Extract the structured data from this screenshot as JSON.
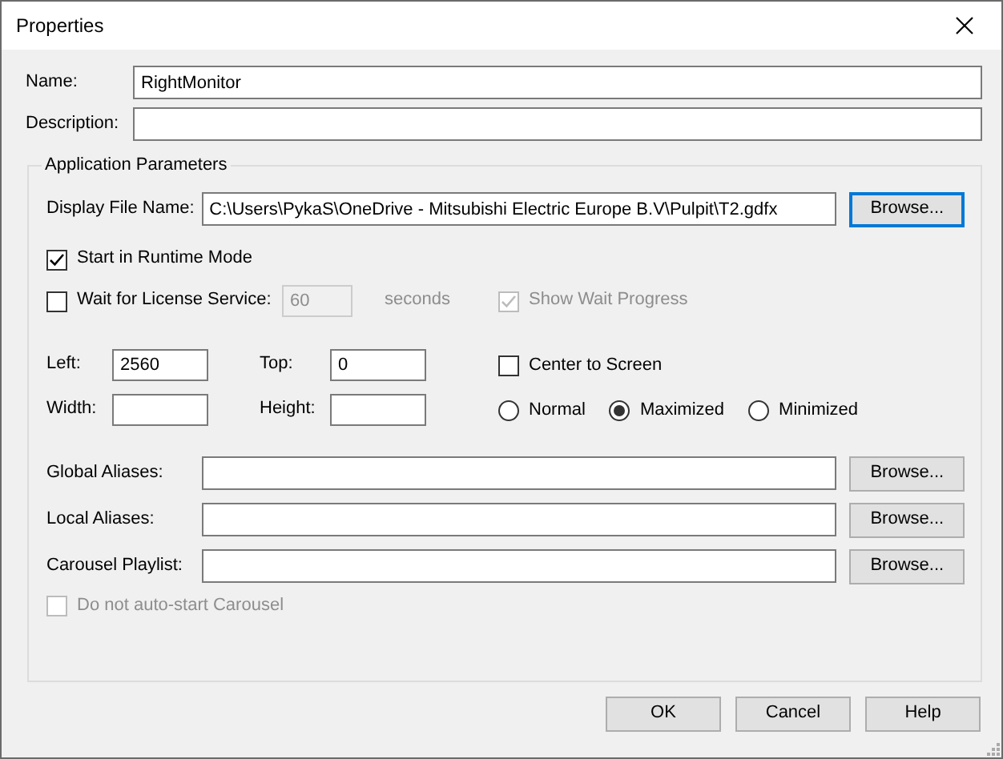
{
  "window": {
    "title": "Properties"
  },
  "fields": [
    {
      "label": "Name:",
      "value": "RightMonitor"
    },
    {
      "label": "Description:"
    }
  ],
  "group": {
    "title": "Application Parameters",
    "display_file": {
      "label": "Display File Name:",
      "value": "C:\\Users\\PykaS\\OneDrive - Mitsubishi Electric Europe B.V\\Pulpit\\T2.gdfx",
      "button": "Browse...",
      "default": true
    },
    "start_runtime": {
      "label": "Start in Runtime Mode",
      "checked": true
    },
    "license": {
      "label": "Wait for License Service:",
      "checked": false,
      "timeout": "60",
      "timeout_disabled": true,
      "unit": "seconds",
      "progress": {
        "label": "Show Wait Progress",
        "checked": true,
        "disabled": true
      }
    },
    "position": [
      {
        "label": "Left:",
        "value": "2560"
      },
      {
        "label": "Top:",
        "value": "0"
      },
      {
        "label": "Width:"
      },
      {
        "label": "Height:"
      }
    ],
    "center": {
      "label": "Center to Screen",
      "checked": false
    },
    "window_states": [
      {
        "label": "Normal",
        "selected": false
      },
      {
        "label": "Maximized",
        "selected": true
      },
      {
        "label": "Minimized",
        "selected": false
      }
    ],
    "aliases": [
      {
        "label": "Global Aliases:",
        "button": "Browse..."
      },
      {
        "label": "Local Aliases:",
        "button": "Browse..."
      },
      {
        "label": "Carousel Playlist:",
        "button": "Browse..."
      }
    ],
    "auto_start": {
      "label": "Do not auto-start Carousel",
      "checked": false,
      "disabled": true
    }
  },
  "buttons": [
    "OK",
    "Cancel",
    "Help"
  ]
}
